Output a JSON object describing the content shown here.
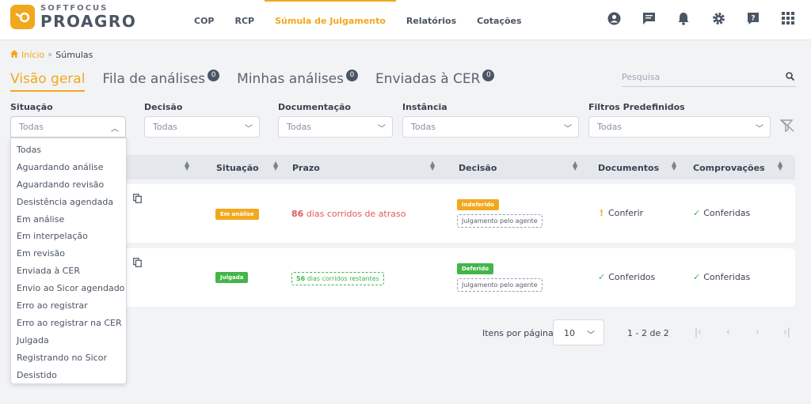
{
  "colors": {
    "accent": "#f2a81d",
    "success": "#43b549",
    "danger": "#e05a5a",
    "badge": "#4b5563"
  },
  "brand": {
    "small": "SOFTFOCUS",
    "big": "PROAGRO"
  },
  "nav": [
    {
      "label": "COP"
    },
    {
      "label": "RCP"
    },
    {
      "label": "Súmula de Julgamento"
    },
    {
      "label": "Relatórios"
    },
    {
      "label": "Cotações"
    }
  ],
  "nav_active": "Súmula de Julgamento",
  "top_icons": [
    "user-icon",
    "chat-icon",
    "bell-icon",
    "gear-icon",
    "help-icon",
    "apps-grid-icon"
  ],
  "breadcrumb": {
    "home": "Início",
    "separator": "»",
    "current": "Súmulas"
  },
  "tabs": [
    {
      "label": "Visão geral",
      "badge": ""
    },
    {
      "label": "Fila de análises",
      "badge": "0"
    },
    {
      "label": "Minhas análises",
      "badge": "0"
    },
    {
      "label": "Enviadas à CER",
      "badge": "0"
    }
  ],
  "search": {
    "placeholder": "Pesquisa"
  },
  "filters": [
    {
      "label": "Situação",
      "value": "Todas"
    },
    {
      "label": "Decisão",
      "value": "Todas"
    },
    {
      "label": "Documentação",
      "value": "Todas"
    },
    {
      "label": "Instância",
      "value": "Todas"
    },
    {
      "label": "Filtros Predefinidos",
      "value": "Todas"
    }
  ],
  "situacao_options": [
    "Todas",
    "Aguardando análise",
    "Aguardando revisão",
    "Desistência agendada",
    "Em análise",
    "Em interpelação",
    "Em revisão",
    "Enviada à CER",
    "Envio ao Sicor agendado",
    "Erro ao registrar",
    "Erro ao registrar na CER",
    "Julgada",
    "Registrando no Sicor",
    "Desistido"
  ],
  "table": {
    "columns": [
      "Situação",
      "Prazo",
      "Decisão",
      "Documentos",
      "Comprovações"
    ],
    "rows": [
      {
        "situacao": "Em análise",
        "prazo_num": "86",
        "prazo_text": "dias corridos de atraso",
        "decisao": "Indeferido",
        "decisao_sub": "Julgamento pelo agente",
        "documentos": "Conferir",
        "comprovacoes": "Conferidas"
      },
      {
        "situacao": "Julgada",
        "prazo_num": "56",
        "prazo_text": "dias corridos restantes",
        "decisao": "Deferido",
        "decisao_sub": "Julgamento pelo agente",
        "documentos": "Conferidos",
        "comprovacoes": "Conferidas"
      }
    ]
  },
  "pagination": {
    "label": "Itens por página",
    "per_page": "10",
    "range": "1 - 2 de 2"
  }
}
